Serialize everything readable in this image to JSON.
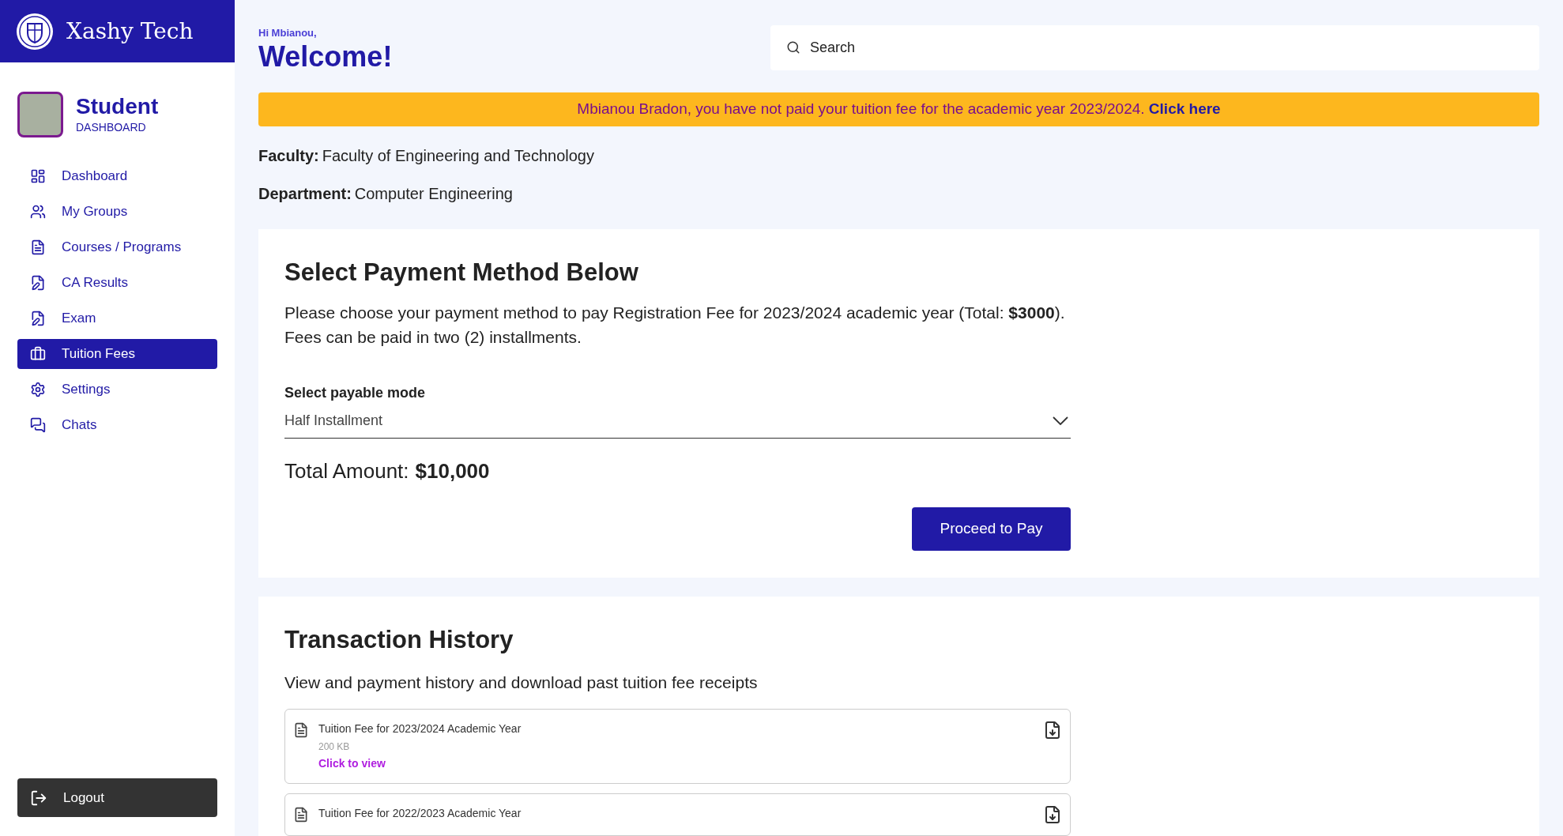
{
  "brand": {
    "name": "Xashy Tech"
  },
  "profile": {
    "role": "Student",
    "subtitle": "DASHBOARD"
  },
  "nav": [
    {
      "label": "Dashboard",
      "selected": false
    },
    {
      "label": "My Groups",
      "selected": false
    },
    {
      "label": "Courses / Programs",
      "selected": false
    },
    {
      "label": "CA Results",
      "selected": false
    },
    {
      "label": "Exam",
      "selected": false
    },
    {
      "label": "Tuition Fees",
      "selected": true
    },
    {
      "label": "Settings",
      "selected": false
    },
    {
      "label": "Chats",
      "selected": false
    }
  ],
  "logout": "Logout",
  "greeting": "Hi Mbianou,",
  "welcome": "Welcome!",
  "search": {
    "placeholder": "Search"
  },
  "alert": {
    "text": "Mbianou Bradon, you have not paid your tuition fee for the academic year 2023/2024.",
    "link": "Click here"
  },
  "info": [
    {
      "label": "Faculty:",
      "value": "Faculty of Engineering and Technology"
    },
    {
      "label": "Department:",
      "value": "Computer Engineering"
    }
  ],
  "payment": {
    "title": "Select Payment Method Below",
    "description": "Please choose your payment method to pay Registration Fee for 2023/2024 academic year (Total: **$3000**). Fees can be paid in two (2) installments.",
    "mode_label": "Select payable mode",
    "mode_value": "Half Installment",
    "total_label": "Total Amount:",
    "total_value": "$10,000",
    "button": "Proceed to Pay"
  },
  "history": {
    "title": "Transaction History",
    "description": "View and payment history and download past tuition fee receipts",
    "items": [
      {
        "title": "Tuition Fee for 2023/2024 Academic Year",
        "size": "200 KB",
        "link": "Click to view"
      },
      {
        "title": "Tuition Fee for 2022/2023 Academic Year"
      }
    ]
  }
}
